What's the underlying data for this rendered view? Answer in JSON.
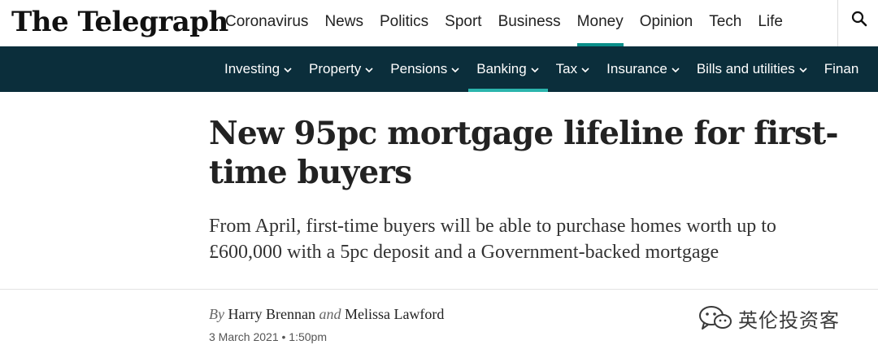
{
  "header": {
    "logo": "The Telegraph",
    "nav": [
      "Coronavirus",
      "News",
      "Politics",
      "Sport",
      "Business",
      "Money",
      "Opinion",
      "Tech",
      "Life"
    ],
    "active_nav": "Money",
    "search_icon": "search-icon"
  },
  "subnav": {
    "items": [
      "Investing",
      "Property",
      "Pensions",
      "Banking",
      "Tax",
      "Insurance",
      "Bills and utilities",
      "Finan"
    ],
    "active": "Banking"
  },
  "article": {
    "headline": "New 95pc mortgage lifeline for first-time buyers",
    "standfirst": "From April, first-time buyers will be able to purchase homes worth up to £600,000 with a 5pc deposit and a Government-backed mortgage",
    "byline_prefix": "By",
    "author1": "Harry Brennan",
    "byline_joiner": "and",
    "author2": "Melissa Lawford",
    "date": "3 March 2021 • 1:50pm"
  },
  "watermark": {
    "text": "英伦投资客",
    "icon": "wechat-icon"
  },
  "colors": {
    "subnav_bg": "#0b2e3b",
    "accent": "#0a8f8a",
    "accent_subnav": "#2bb5ad"
  }
}
